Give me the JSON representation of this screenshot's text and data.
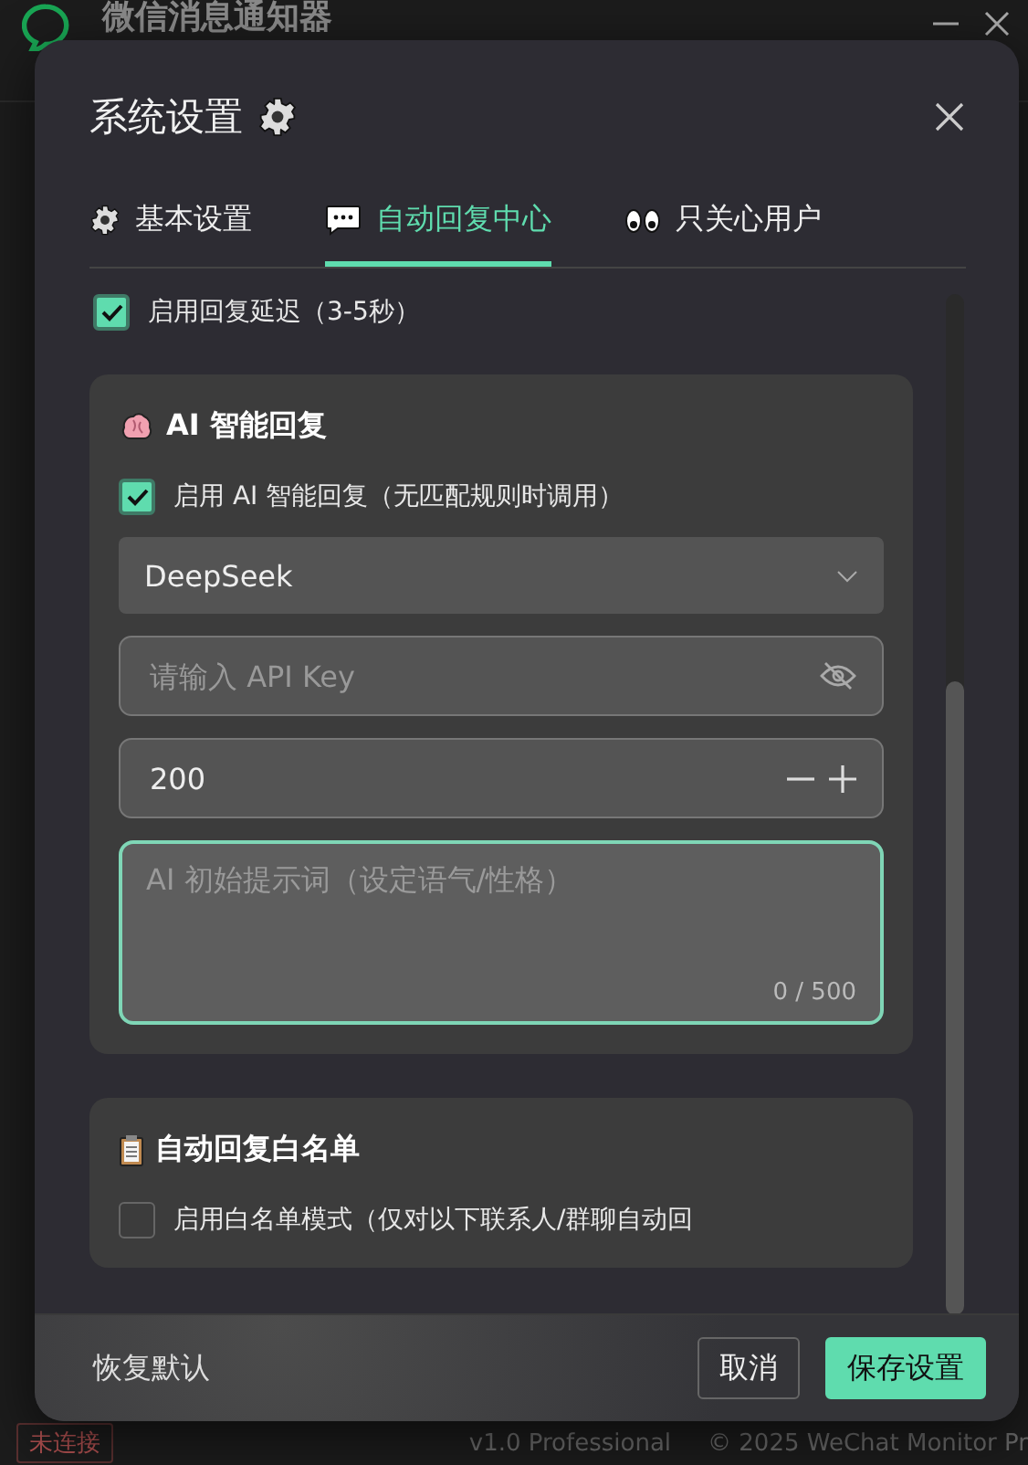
{
  "app": {
    "title": "微信消息通知器",
    "status": "未连接",
    "version": "v1.0 Professional",
    "copyright": "© 2025 WeChat Monitor Pr"
  },
  "dialog": {
    "title": "系统设置",
    "tabs": [
      {
        "label": "基本设置",
        "kind": "gear",
        "selected": false
      },
      {
        "label": "自动回复中心",
        "kind": "chat",
        "selected": true
      },
      {
        "label": "只关心用户",
        "kind": "eyes",
        "selected": false
      }
    ],
    "delay": {
      "label": "启用回复延迟（3-5秒）",
      "checked": true
    },
    "ai_section": {
      "title": "AI 智能回复",
      "enable": {
        "label": "启用 AI 智能回复（无匹配规则时调用）",
        "checked": true
      },
      "model": "DeepSeek",
      "api_key": {
        "placeholder": "请输入 API Key"
      },
      "max_tokens": "200",
      "prompt": {
        "placeholder": "AI 初始提示词（设定语气/性格）",
        "counter": "0 / 500",
        "focused": true
      }
    },
    "whitelist_section": {
      "title": "自动回复白名单",
      "enable": {
        "label": "启用白名单模式（仅对以下联系人/群聊自动回",
        "checked": false
      }
    },
    "buttons": {
      "reset": "恢复默认",
      "cancel": "取消",
      "save": "保存设置"
    }
  }
}
